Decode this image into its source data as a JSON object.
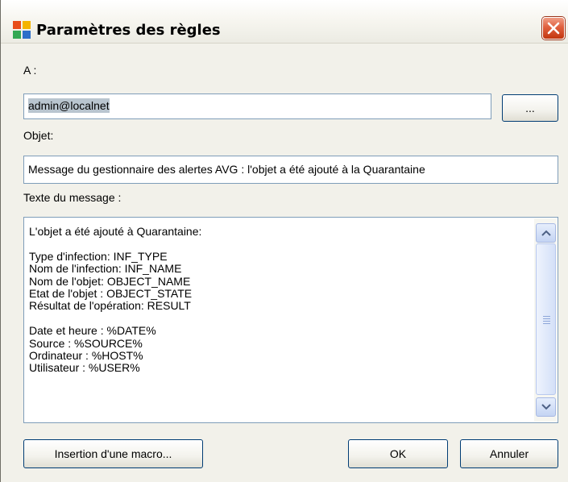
{
  "window": {
    "title": "Paramètres des règles",
    "close_icon": "close-icon"
  },
  "to": {
    "label": "A :",
    "value": "admin@localnet",
    "browse_label": "..."
  },
  "subject": {
    "label": "Objet:",
    "value": "Message du gestionnaire des alertes AVG : l'objet a été ajouté à la Quarantaine"
  },
  "message": {
    "label": "Texte du message :",
    "body": "L'objet a été ajouté à Quarantaine:\n\nType d'infection: INF_TYPE\nNom de l'infection: INF_NAME\nNom de l'objet: OBJECT_NAME\nEtat de l'objet : OBJECT_STATE\nRésultat de l'opération: RESULT\n\nDate et heure : %DATE%\nSource : %SOURCE%\nOrdinateur : %HOST%\nUtilisateur : %USER%"
  },
  "buttons": {
    "macro": "Insertion d'une macro...",
    "ok": "OK",
    "cancel": "Annuler"
  },
  "colors": {
    "title_close": "#d8542f",
    "field_border": "#7f9db9",
    "button_border": "#003c74",
    "selection": "#b9c5cf"
  }
}
